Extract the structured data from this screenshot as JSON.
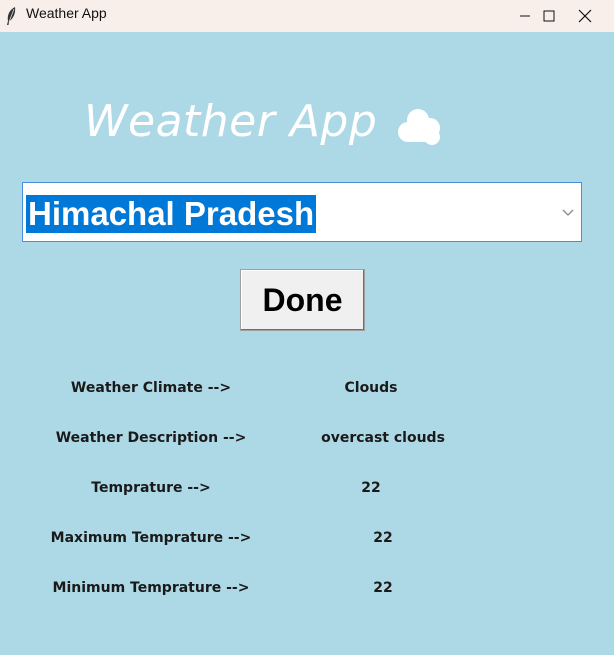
{
  "window": {
    "title": "Weather App",
    "icons": {
      "app": "feather-icon",
      "minimize": "minimize-icon",
      "maximize": "maximize-icon",
      "close": "close-icon"
    }
  },
  "header": {
    "title": "Weather App",
    "icon": "cloud-icon"
  },
  "state_select": {
    "selected_value": "Himachal Pradesh",
    "highlight_color": "#0078d7"
  },
  "done_button": {
    "label": "Done"
  },
  "results": [
    {
      "label": "Weather Climate -->",
      "value": "Clouds"
    },
    {
      "label": "Weather Description -->",
      "value": "overcast clouds"
    },
    {
      "label": "Temprature -->",
      "value": "22"
    },
    {
      "label": "Maximum Temprature -->",
      "value": "22"
    },
    {
      "label": "Minimum Temprature -->",
      "value": "22"
    }
  ],
  "colors": {
    "background": "#add8e6",
    "titlebar": "#f9efea"
  }
}
